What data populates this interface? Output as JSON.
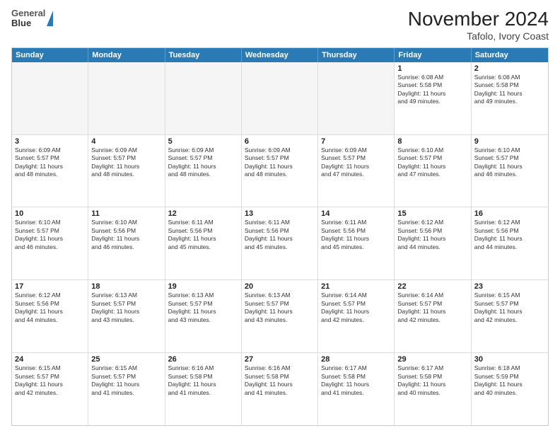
{
  "logo": {
    "line1": "General",
    "line2": "Blue"
  },
  "title": "November 2024",
  "subtitle": "Tafolo, Ivory Coast",
  "days": [
    "Sunday",
    "Monday",
    "Tuesday",
    "Wednesday",
    "Thursday",
    "Friday",
    "Saturday"
  ],
  "rows": [
    [
      {
        "num": "",
        "info": ""
      },
      {
        "num": "",
        "info": ""
      },
      {
        "num": "",
        "info": ""
      },
      {
        "num": "",
        "info": ""
      },
      {
        "num": "",
        "info": ""
      },
      {
        "num": "1",
        "info": "Sunrise: 6:08 AM\nSunset: 5:58 PM\nDaylight: 11 hours\nand 49 minutes."
      },
      {
        "num": "2",
        "info": "Sunrise: 6:08 AM\nSunset: 5:58 PM\nDaylight: 11 hours\nand 49 minutes."
      }
    ],
    [
      {
        "num": "3",
        "info": "Sunrise: 6:09 AM\nSunset: 5:57 PM\nDaylight: 11 hours\nand 48 minutes."
      },
      {
        "num": "4",
        "info": "Sunrise: 6:09 AM\nSunset: 5:57 PM\nDaylight: 11 hours\nand 48 minutes."
      },
      {
        "num": "5",
        "info": "Sunrise: 6:09 AM\nSunset: 5:57 PM\nDaylight: 11 hours\nand 48 minutes."
      },
      {
        "num": "6",
        "info": "Sunrise: 6:09 AM\nSunset: 5:57 PM\nDaylight: 11 hours\nand 48 minutes."
      },
      {
        "num": "7",
        "info": "Sunrise: 6:09 AM\nSunset: 5:57 PM\nDaylight: 11 hours\nand 47 minutes."
      },
      {
        "num": "8",
        "info": "Sunrise: 6:10 AM\nSunset: 5:57 PM\nDaylight: 11 hours\nand 47 minutes."
      },
      {
        "num": "9",
        "info": "Sunrise: 6:10 AM\nSunset: 5:57 PM\nDaylight: 11 hours\nand 46 minutes."
      }
    ],
    [
      {
        "num": "10",
        "info": "Sunrise: 6:10 AM\nSunset: 5:57 PM\nDaylight: 11 hours\nand 46 minutes."
      },
      {
        "num": "11",
        "info": "Sunrise: 6:10 AM\nSunset: 5:56 PM\nDaylight: 11 hours\nand 46 minutes."
      },
      {
        "num": "12",
        "info": "Sunrise: 6:11 AM\nSunset: 5:56 PM\nDaylight: 11 hours\nand 45 minutes."
      },
      {
        "num": "13",
        "info": "Sunrise: 6:11 AM\nSunset: 5:56 PM\nDaylight: 11 hours\nand 45 minutes."
      },
      {
        "num": "14",
        "info": "Sunrise: 6:11 AM\nSunset: 5:56 PM\nDaylight: 11 hours\nand 45 minutes."
      },
      {
        "num": "15",
        "info": "Sunrise: 6:12 AM\nSunset: 5:56 PM\nDaylight: 11 hours\nand 44 minutes."
      },
      {
        "num": "16",
        "info": "Sunrise: 6:12 AM\nSunset: 5:56 PM\nDaylight: 11 hours\nand 44 minutes."
      }
    ],
    [
      {
        "num": "17",
        "info": "Sunrise: 6:12 AM\nSunset: 5:56 PM\nDaylight: 11 hours\nand 44 minutes."
      },
      {
        "num": "18",
        "info": "Sunrise: 6:13 AM\nSunset: 5:57 PM\nDaylight: 11 hours\nand 43 minutes."
      },
      {
        "num": "19",
        "info": "Sunrise: 6:13 AM\nSunset: 5:57 PM\nDaylight: 11 hours\nand 43 minutes."
      },
      {
        "num": "20",
        "info": "Sunrise: 6:13 AM\nSunset: 5:57 PM\nDaylight: 11 hours\nand 43 minutes."
      },
      {
        "num": "21",
        "info": "Sunrise: 6:14 AM\nSunset: 5:57 PM\nDaylight: 11 hours\nand 42 minutes."
      },
      {
        "num": "22",
        "info": "Sunrise: 6:14 AM\nSunset: 5:57 PM\nDaylight: 11 hours\nand 42 minutes."
      },
      {
        "num": "23",
        "info": "Sunrise: 6:15 AM\nSunset: 5:57 PM\nDaylight: 11 hours\nand 42 minutes."
      }
    ],
    [
      {
        "num": "24",
        "info": "Sunrise: 6:15 AM\nSunset: 5:57 PM\nDaylight: 11 hours\nand 42 minutes."
      },
      {
        "num": "25",
        "info": "Sunrise: 6:15 AM\nSunset: 5:57 PM\nDaylight: 11 hours\nand 41 minutes."
      },
      {
        "num": "26",
        "info": "Sunrise: 6:16 AM\nSunset: 5:58 PM\nDaylight: 11 hours\nand 41 minutes."
      },
      {
        "num": "27",
        "info": "Sunrise: 6:16 AM\nSunset: 5:58 PM\nDaylight: 11 hours\nand 41 minutes."
      },
      {
        "num": "28",
        "info": "Sunrise: 6:17 AM\nSunset: 5:58 PM\nDaylight: 11 hours\nand 41 minutes."
      },
      {
        "num": "29",
        "info": "Sunrise: 6:17 AM\nSunset: 5:58 PM\nDaylight: 11 hours\nand 40 minutes."
      },
      {
        "num": "30",
        "info": "Sunrise: 6:18 AM\nSunset: 5:59 PM\nDaylight: 11 hours\nand 40 minutes."
      }
    ]
  ]
}
